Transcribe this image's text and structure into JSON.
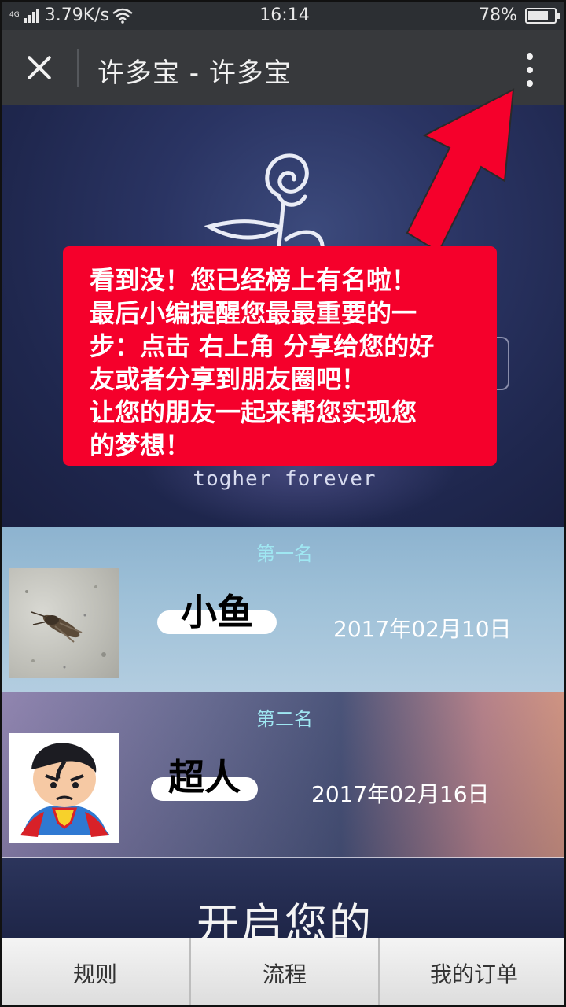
{
  "status_bar": {
    "network_type": "4G",
    "speed": "3.79K/s",
    "time": "16:14",
    "battery_percent": "78%",
    "battery_level": 0.78,
    "icons": [
      "signal-icon",
      "wifi-icon",
      "battery-icon"
    ]
  },
  "title_bar": {
    "title": "许多宝 - 许多宝",
    "close_icon": "close-icon",
    "more_icon": "more-vertical-icon"
  },
  "hero": {
    "subtitle": "togher forever",
    "logo_icon": "rose-icon"
  },
  "callout": {
    "text": "看到没！您已经榜上有名啦！\n最后小编提醒您最最重要的一\n步：点击 右上角 分享给您的好\n友或者分享到朋友圈吧！\n让您的朋友一起来帮您实现您\n的梦想！",
    "color": "#f5002b"
  },
  "ranking": [
    {
      "rank_label": "第一名",
      "name": "小鱼",
      "date": "2017年02月10日",
      "avatar_icon": "insect-photo"
    },
    {
      "rank_label": "第二名",
      "name": "超人",
      "date": "2017年02月16日",
      "avatar_icon": "superman-avatar"
    }
  ],
  "section3": {
    "title": "开启您的"
  },
  "bottom_nav": {
    "items": [
      "规则",
      "流程",
      "我的订单"
    ]
  }
}
